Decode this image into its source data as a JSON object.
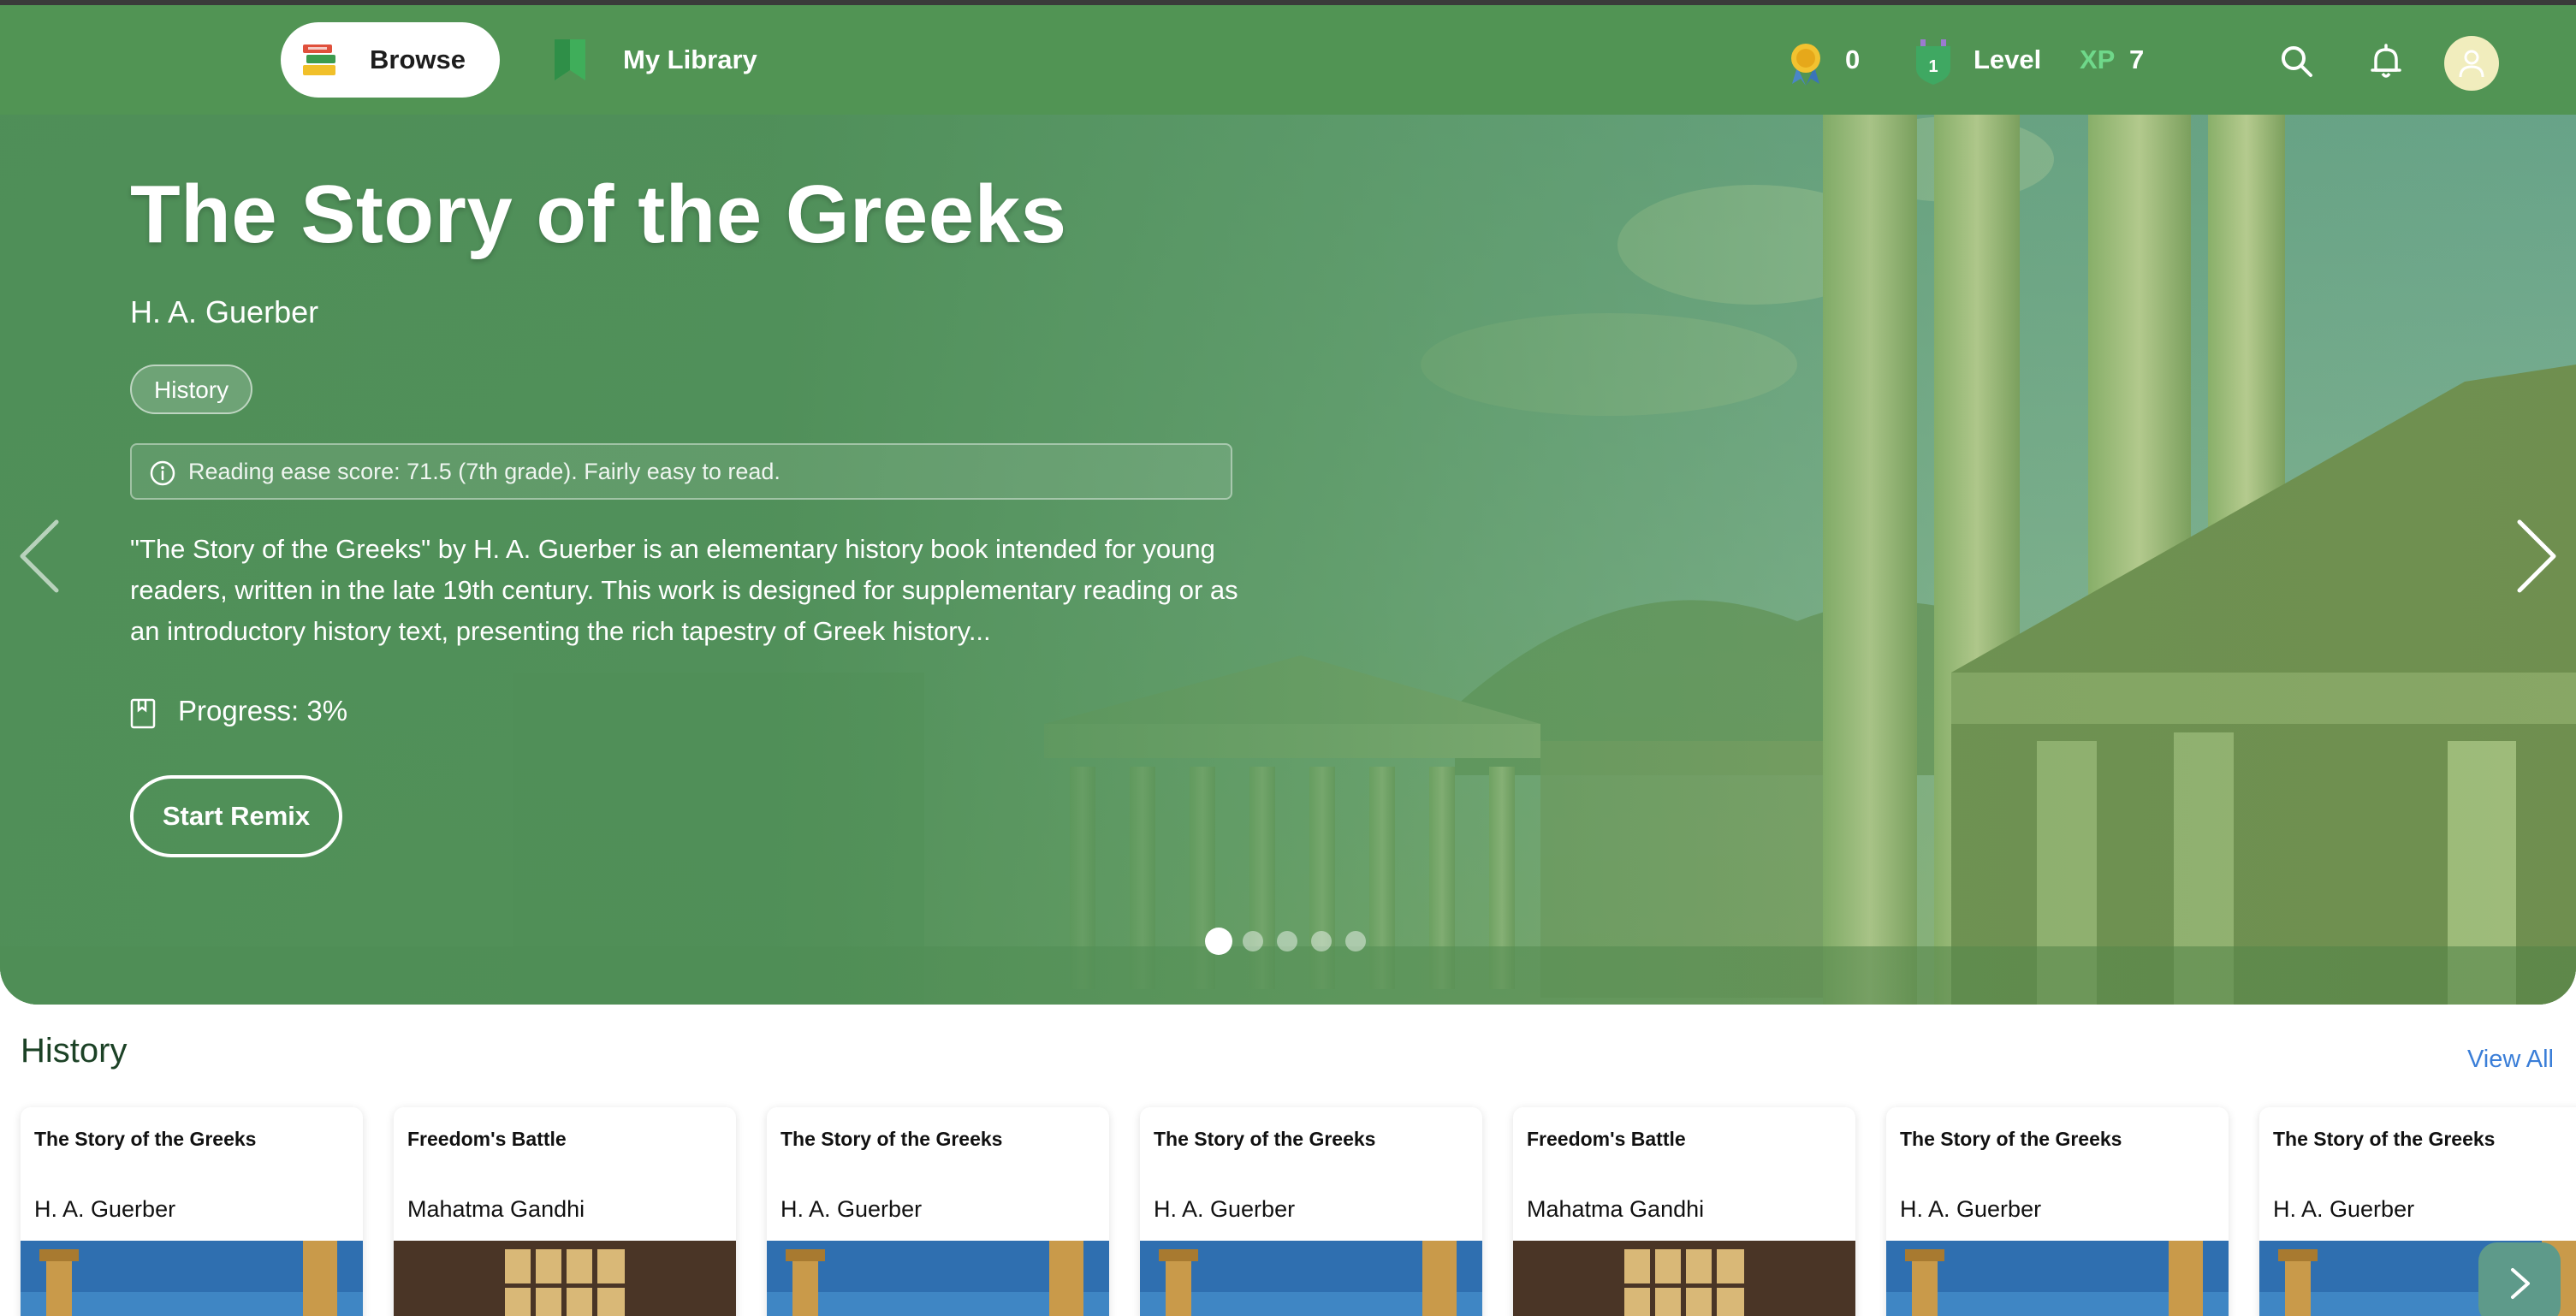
{
  "nav": {
    "browse_label": "Browse",
    "library_label": "My Library",
    "badges_count": "0",
    "level_label": "Level",
    "level_value": "1",
    "xp_label": "XP",
    "xp_value": "7"
  },
  "hero": {
    "title": "The Story of the Greeks",
    "author": "H. A. Guerber",
    "tag": "History",
    "reading_ease": "Reading ease score: 71.5 (7th grade). Fairly easy to read.",
    "description": "\"The Story of the Greeks\" by H. A. Guerber is an elementary history book intended for young readers, written in the late 19th century. This work is designed for supplementary reading or as an introductory history text, presenting the rich tapestry of Greek history...",
    "progress_text": "Progress: 3%",
    "progress_value": 0.03,
    "cta_label": "Start Remix",
    "slide_count": 5,
    "active_slide": 1
  },
  "section": {
    "title": "History",
    "view_all_label": "View All",
    "books": [
      {
        "title": "The Story of the Greeks",
        "author": "H. A. Guerber",
        "cover": "greek-temple"
      },
      {
        "title": "Freedom's Battle",
        "author": "Mahatma Gandhi",
        "cover": "prison-window"
      },
      {
        "title": "The Story of the Greeks",
        "author": "H. A. Guerber",
        "cover": "greek-temple"
      },
      {
        "title": "The Story of the Greeks",
        "author": "H. A. Guerber",
        "cover": "greek-temple"
      },
      {
        "title": "Freedom's Battle",
        "author": "Mahatma Gandhi",
        "cover": "prison-window"
      },
      {
        "title": "The Story of the Greeks",
        "author": "H. A. Guerber",
        "cover": "greek-temple"
      },
      {
        "title": "The Story of the Greeks",
        "author": "H. A. Guerber",
        "cover": "greek-temple"
      }
    ]
  },
  "colors": {
    "hero_green": "#4e8d55",
    "nav_green": "#519454",
    "xp_green": "#6fd88a",
    "link_blue": "#3a7ed8",
    "section_title": "#1c4226"
  },
  "icons": {
    "browse": "books-icon",
    "library": "bookmark-icon",
    "badges": "medal-icon",
    "level": "level-shield-icon",
    "search": "search-icon",
    "notifications": "bell-icon",
    "avatar": "user-icon"
  }
}
